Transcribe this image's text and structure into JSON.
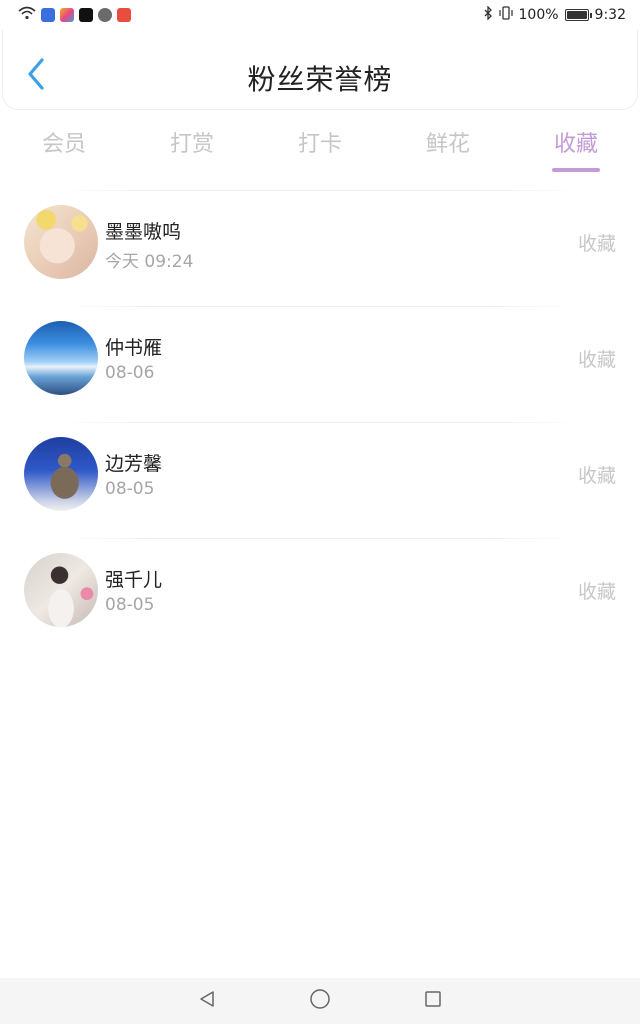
{
  "status_bar": {
    "battery_text": "100%",
    "battery_level": 1.0,
    "time": "9:32"
  },
  "header": {
    "title": "粉丝荣誉榜",
    "back_icon": "chevron-left-icon"
  },
  "tabs": [
    {
      "label": "会员",
      "active": false
    },
    {
      "label": "打赏",
      "active": false
    },
    {
      "label": "打卡",
      "active": false
    },
    {
      "label": "鲜花",
      "active": false
    },
    {
      "label": "收藏",
      "active": true
    }
  ],
  "list": [
    {
      "name": "墨墨嗷呜",
      "time": "今天 09:24",
      "action": "收藏"
    },
    {
      "name": "仲书雁",
      "time": "08-06",
      "action": "收藏"
    },
    {
      "name": "边芳馨",
      "time": "08-05",
      "action": "收藏"
    },
    {
      "name": "强千儿",
      "time": "08-05",
      "action": "收藏"
    }
  ],
  "colors": {
    "accent": "#c59bd6",
    "back_icon": "#3aa0e8",
    "inactive_tab": "#c6c6c6",
    "secondary_text": "#a6a6a6"
  },
  "navbar": {
    "icons": [
      "back-triangle-icon",
      "home-circle-icon",
      "recents-square-icon"
    ]
  }
}
